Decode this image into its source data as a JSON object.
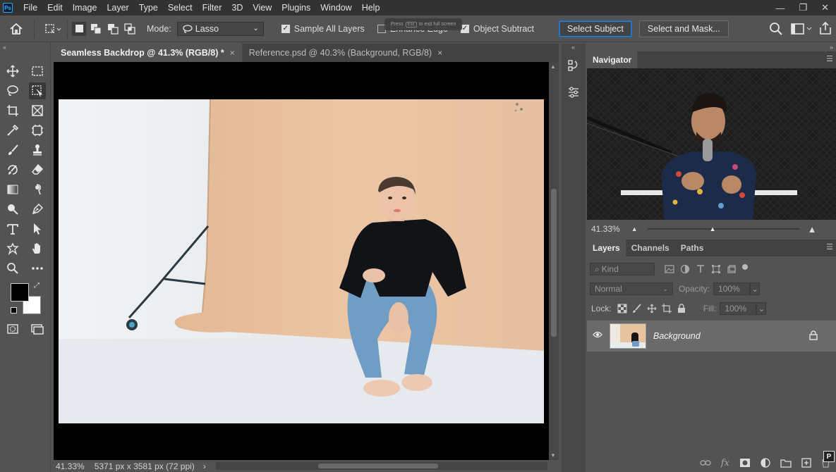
{
  "app": {
    "logo_text": "Ps"
  },
  "menu": [
    "File",
    "Edit",
    "Image",
    "Layer",
    "Type",
    "Select",
    "Filter",
    "3D",
    "View",
    "Plugins",
    "Window",
    "Help"
  ],
  "window_controls": {
    "minimize": "—",
    "restore": "❐",
    "close": "✕"
  },
  "options": {
    "mode_label": "Mode:",
    "mode_value": "Lasso",
    "sample_all_layers": "Sample All Layers",
    "sample_all_layers_checked": true,
    "enhance_edge": "Enhance Edge",
    "enhance_edge_checked": false,
    "object_subtract": "Object Subtract",
    "object_subtract_checked": true,
    "select_subject": "Select Subject",
    "select_and_mask": "Select and Mask...",
    "fullscreen_hint_press": "Press",
    "fullscreen_hint_key": "Esc",
    "fullscreen_hint_rest": "to exit full screen"
  },
  "document": {
    "tabs": [
      {
        "label": "Seamless Backdrop @ 41.3% (RGB/8) *",
        "active": true
      },
      {
        "label": "Reference.psd @ 40.3% (Background, RGB/8)",
        "active": false
      }
    ],
    "tab_close": "×",
    "status_zoom": "41.33%",
    "status_info": "5371 px x 3581 px (72 ppi)",
    "status_arrow": "›"
  },
  "navigator": {
    "title": "Navigator",
    "zoom": "41.33%"
  },
  "layers_panel": {
    "tabs": [
      "Layers",
      "Channels",
      "Paths"
    ],
    "kind_placeholder": "Kind",
    "blend_mode": "Normal",
    "opacity_label": "Opacity:",
    "opacity_value": "100%",
    "lock_label": "Lock:",
    "fill_label": "Fill:",
    "fill_value": "100%",
    "layers": [
      {
        "name": "Background",
        "visible": true,
        "locked": true
      }
    ]
  },
  "colors": {
    "accent": "#1f6fc5",
    "backdrop_paper": "#e9c3a0",
    "panel_bg": "#535353",
    "menubar_bg": "#323232"
  }
}
